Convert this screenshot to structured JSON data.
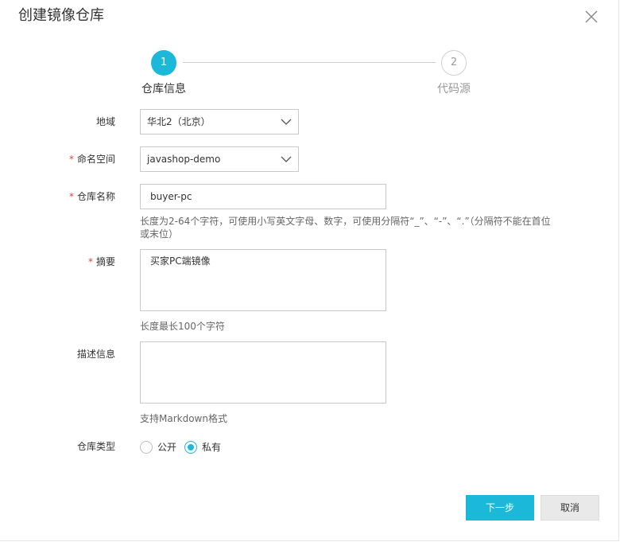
{
  "dialog": {
    "title": "创建镜像仓库",
    "close_icon": "close-icon"
  },
  "steps": [
    {
      "number": "1",
      "label": "仓库信息",
      "state": "active"
    },
    {
      "number": "2",
      "label": "代码源",
      "state": "pending"
    }
  ],
  "form": {
    "region": {
      "label": "地域",
      "required": false,
      "value": "华北2（北京）"
    },
    "namespace": {
      "label": "命名空间",
      "required": true,
      "value": "javashop-demo"
    },
    "repo_name": {
      "label": "仓库名称",
      "required": true,
      "value": "buyer-pc",
      "help_line1": "长度为2-64个字符，可使用小写英文字母、数字，可使用分隔符“_”、“-”、“.”（分隔符不能在首位",
      "help_line2": "或末位）"
    },
    "summary": {
      "label": "摘要",
      "required": true,
      "value": "买家PC端镜像",
      "help": "长度最长100个字符"
    },
    "description": {
      "label": "描述信息",
      "required": false,
      "value": "",
      "help": "支持Markdown格式"
    },
    "repo_type": {
      "label": "仓库类型",
      "options": [
        {
          "label": "公开",
          "checked": false
        },
        {
          "label": "私有",
          "checked": true
        }
      ]
    },
    "required_mark": "*"
  },
  "footer": {
    "next_label": "下一步",
    "cancel_label": "取消"
  },
  "colors": {
    "accent": "#1bb8d9",
    "required": "#e0423a"
  }
}
